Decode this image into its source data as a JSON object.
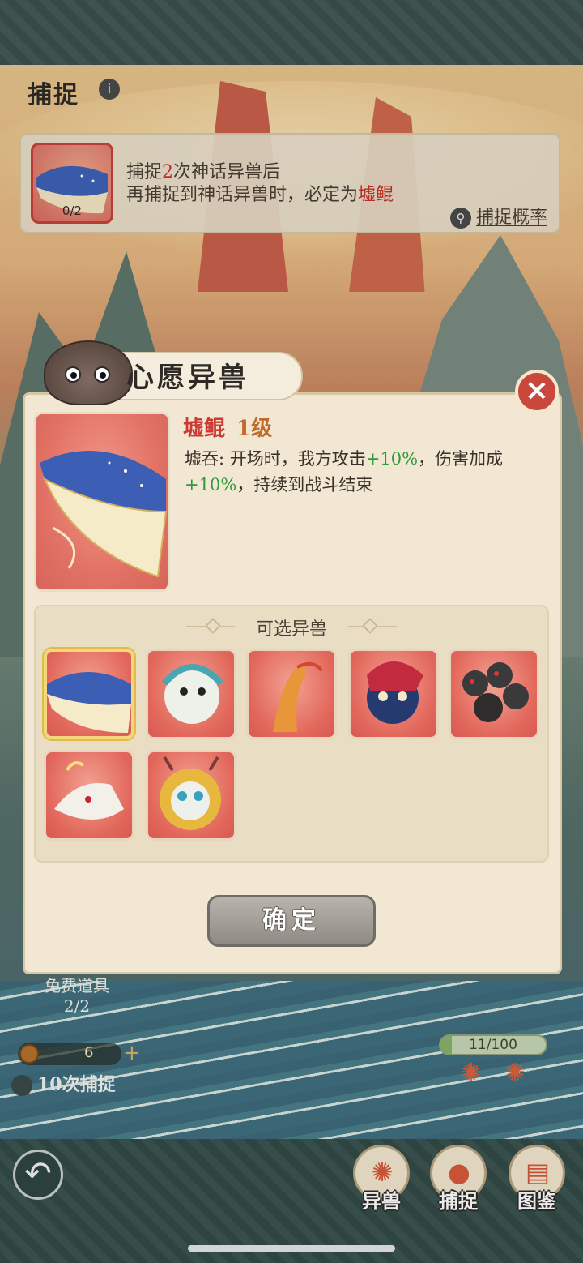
{
  "header": {
    "title": "捕捉"
  },
  "guarantee": {
    "count": "0/2",
    "line1_pre": "捕捉",
    "line1_num": "2",
    "line1_post": "次神话异兽后",
    "line2_pre": "再捕捉到神话异兽时，必定为",
    "line2_name": "墟鲲",
    "prob_link": "捕捉概率"
  },
  "covered_ui": {
    "free_items_label": "免费道具",
    "free_items_count": "2/2",
    "coin_count": "6",
    "ten_catch": "10次捕捉",
    "progress_text": "11/100",
    "progress_fraction": 0.11
  },
  "nav": {
    "beasts": "异兽",
    "catch": "捕捉",
    "atlas": "图鉴"
  },
  "modal": {
    "title": "心愿异兽",
    "beast_name": "墟鲲",
    "beast_level": "1级",
    "skill_name": "墟吞: ",
    "desc_a": "开场时，我方攻击",
    "desc_b": "+10%",
    "desc_c": "，伤害加成",
    "desc_d": "+10%",
    "desc_e": "，持续到战斗结束",
    "select_title": "可选异兽",
    "confirm": "确定"
  },
  "icons": {
    "info": "info-icon",
    "search": "magnifier-icon",
    "close": "close-icon",
    "back": "back-arrow-icon"
  },
  "colors": {
    "accent_red": "#c8332d",
    "buff_green": "#2f9a3a",
    "level_orange": "#c16a2b"
  }
}
